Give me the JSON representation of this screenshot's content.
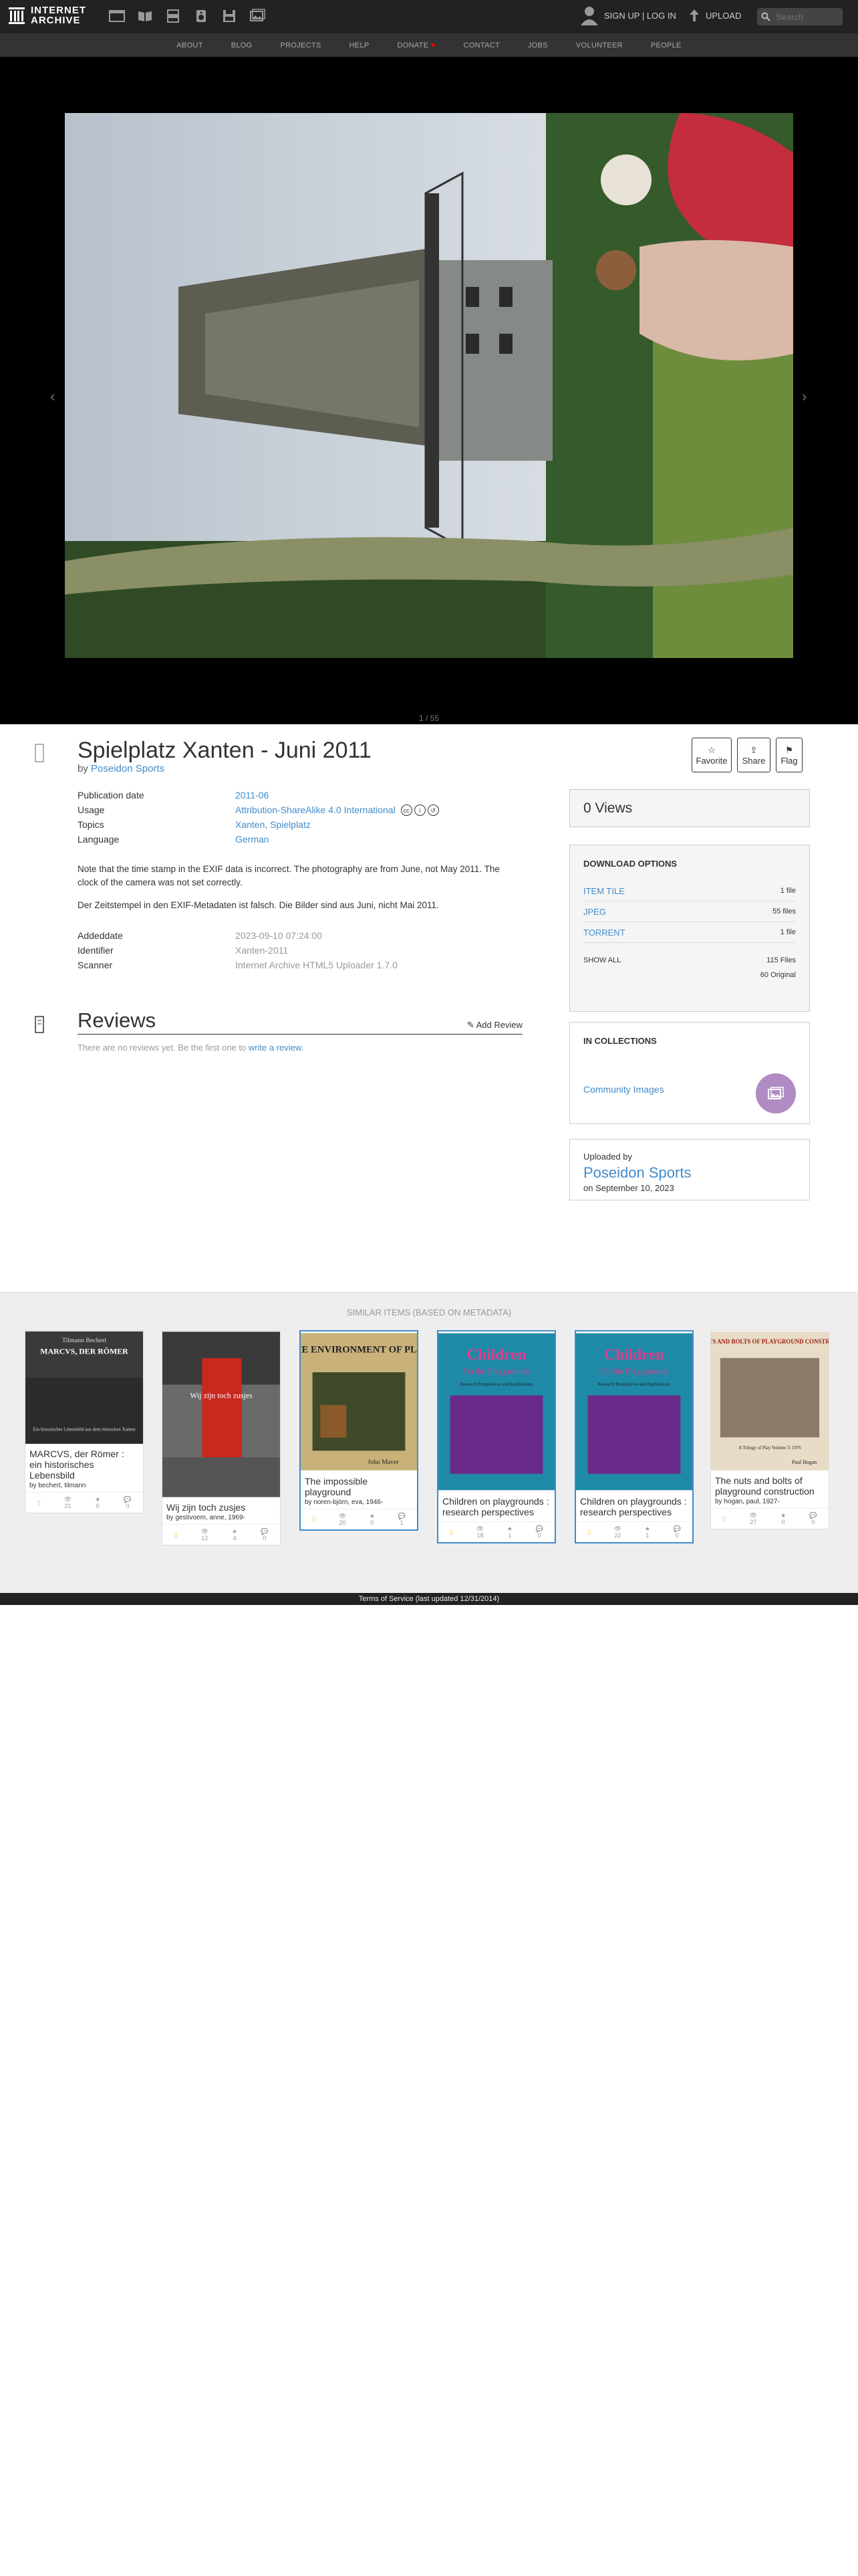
{
  "header": {
    "logo_line1": "INTERNET",
    "logo_line2": "ARCHIVE",
    "signup_login": "SIGN UP | LOG IN",
    "upload": "UPLOAD",
    "search_placeholder": "Search"
  },
  "nav": [
    "ABOUT",
    "BLOG",
    "PROJECTS",
    "HELP",
    "DONATE",
    "CONTACT",
    "JOBS",
    "VOLUNTEER",
    "PEOPLE"
  ],
  "viewer": {
    "page_count": "1 / 55"
  },
  "item": {
    "title": "Spielplatz Xanten - Juni 2011",
    "by_label": "by",
    "author": "Poseidon Sports",
    "actions": {
      "favorite": "Favorite",
      "share": "Share",
      "flag": "Flag"
    },
    "metadata": [
      {
        "key": "Publication date",
        "value": "2011-06"
      },
      {
        "key": "Usage",
        "value": "Attribution-ShareAlike 4.0 International"
      },
      {
        "key": "Topics",
        "value": "Xanten, Spielplatz"
      },
      {
        "key": "Language",
        "value": "German"
      }
    ],
    "description": [
      "Note that the time stamp in the EXIF data is incorrect. The photography are from June, not May 2011. The clock of the camera was not set correctly.",
      "Der Zeitstempel in den EXIF-Metadaten ist falsch. Die Bilder sind aus Juni, nicht Mai 2011."
    ],
    "metadata2": [
      {
        "key": "Addeddate",
        "value": "2023-09-10 07:24:00"
      },
      {
        "key": "Identifier",
        "value": "Xanten-2011"
      },
      {
        "key": "Scanner",
        "value": "Internet Archive HTML5 Uploader 1.7.0"
      }
    ]
  },
  "reviews": {
    "title": "Reviews",
    "add_review": "Add Review",
    "empty_text": "There are no reviews yet. Be the first one to",
    "write_link": "write a review."
  },
  "sidebar": {
    "views": "0 Views",
    "download_title": "DOWNLOAD OPTIONS",
    "downloads": [
      {
        "label": "ITEM TILE",
        "count": "1 file"
      },
      {
        "label": "JPEG",
        "count": "55 files"
      },
      {
        "label": "TORRENT",
        "count": "1 file"
      }
    ],
    "show_all": "SHOW ALL",
    "total_files": "115 Files",
    "original": "60 Original",
    "collections_title": "IN COLLECTIONS",
    "collection": "Community Images",
    "uploaded_by_label": "Uploaded by",
    "uploader": "Poseidon Sports",
    "upload_date": "on September 10, 2023"
  },
  "similar": {
    "title": "SIMILAR ITEMS (based on metadata)",
    "items": [
      {
        "title": "MARCVS, der Römer : ein historisches Lebensbild",
        "by": "by bechert, tilmann",
        "s1": "21",
        "s2": "0",
        "s3": "0",
        "cover_line1": "Tilmann Bechert",
        "cover_line2": "MARCVS, DER RÖMER",
        "cover_line3": "Ein historisches Lebensbild aus dem römischen Xanten"
      },
      {
        "title": "Wij zijn toch zusjes",
        "by": "by gestivoem, anne, 1969-",
        "s1": "12",
        "s2": "4",
        "s3": "0",
        "cover_line1": "Wij zijn toch zusjes",
        "cover_line2": "",
        "cover_line3": ""
      },
      {
        "title": "The impossible playground",
        "by": "by noren-björn, eva, 1946-",
        "s1": "20",
        "s2": "0",
        "s3": "1",
        "cover_line1": "THE ENVIRONMENT OF PLAY",
        "cover_line2": "John Maver",
        "cover_line3": ""
      },
      {
        "title": "Children on playgrounds : research perspectives",
        "by": "",
        "s1": "18",
        "s2": "1",
        "s3": "0",
        "cover_line1": "Children",
        "cover_line2": "On the Playgrounds",
        "cover_line3": "Research Perspectives and Applications"
      },
      {
        "title": "Children on playgrounds : research perspectives",
        "by": "",
        "s1": "22",
        "s2": "1",
        "s3": "0",
        "cover_line1": "Children",
        "cover_line2": "On the Playgrounds",
        "cover_line3": "Research Perspectives and Applications"
      },
      {
        "title": "The nuts and bolts of playground construction",
        "by": "by hogan, paul, 1927-",
        "s1": "27",
        "s2": "0",
        "s3": "0",
        "cover_line1": "THE NUTS AND BOLTS OF PLAYGROUND CONSTRUCTION",
        "cover_line2": "A Trilogy of Play Volume 3: 1976",
        "cover_line3": "Paul Hogan"
      }
    ]
  },
  "footer": "Terms of Service (last updated 12/31/2014)",
  "colors": {
    "link": "#428bca",
    "topbar": "#222222",
    "nav": "#333333",
    "donate_heart": "#ff0000"
  }
}
